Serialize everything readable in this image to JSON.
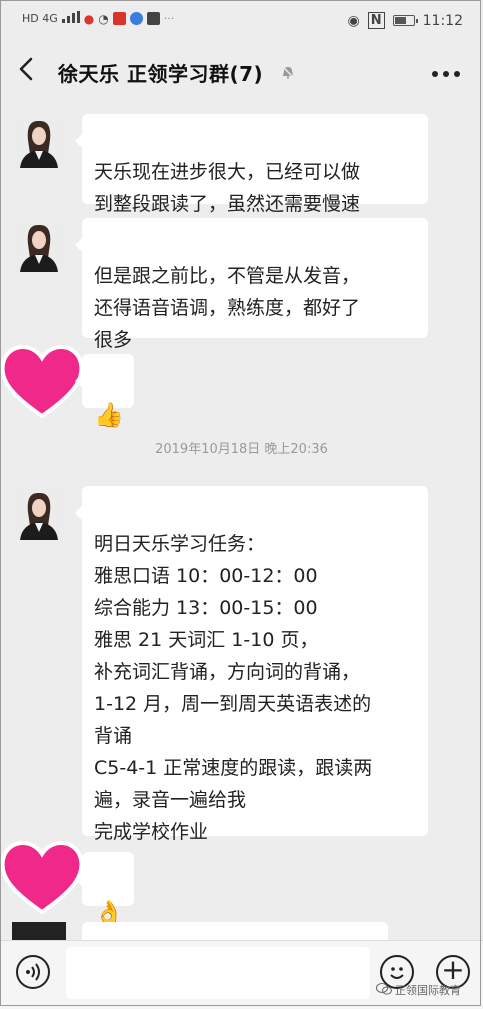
{
  "status_bar": {
    "left_text": "HD 4G",
    "time": "11:12",
    "nfc": "N"
  },
  "header": {
    "title": "徐天乐 正领学习群(7)",
    "more": "⋮"
  },
  "messages": [
    {
      "text": "天乐现在进步很大，已经可以做\n到整段跟读了，虽然还需要慢速"
    },
    {
      "text": "但是跟之前比，不管是从发音，\n还得语音语调，熟练度，都好了\n很多"
    },
    {
      "emoji": "👍"
    },
    {
      "text": "明日天乐学习任务：\n雅思口语  10：00-12：00\n综合能力  13：00-15：00\n雅思 21 天词汇 1-10 页，\n补充词汇背诵，方向词的背诵，\n1-12 月，周一到周天英语表述的\n背诵\nC5-4-1 正常速度的跟读，跟读两\n遍，录音一遍给我\n完成学校作业"
    },
    {
      "emoji": "👌"
    }
  ],
  "timestamp": "2019年10月18日 晚上20:36",
  "input_bar": {
    "placeholder": "",
    "plus": "+"
  },
  "watermark": "正领国际教育",
  "colors": {
    "background": "#ededed",
    "bubble": "#ffffff",
    "heart": "#f0288a"
  }
}
